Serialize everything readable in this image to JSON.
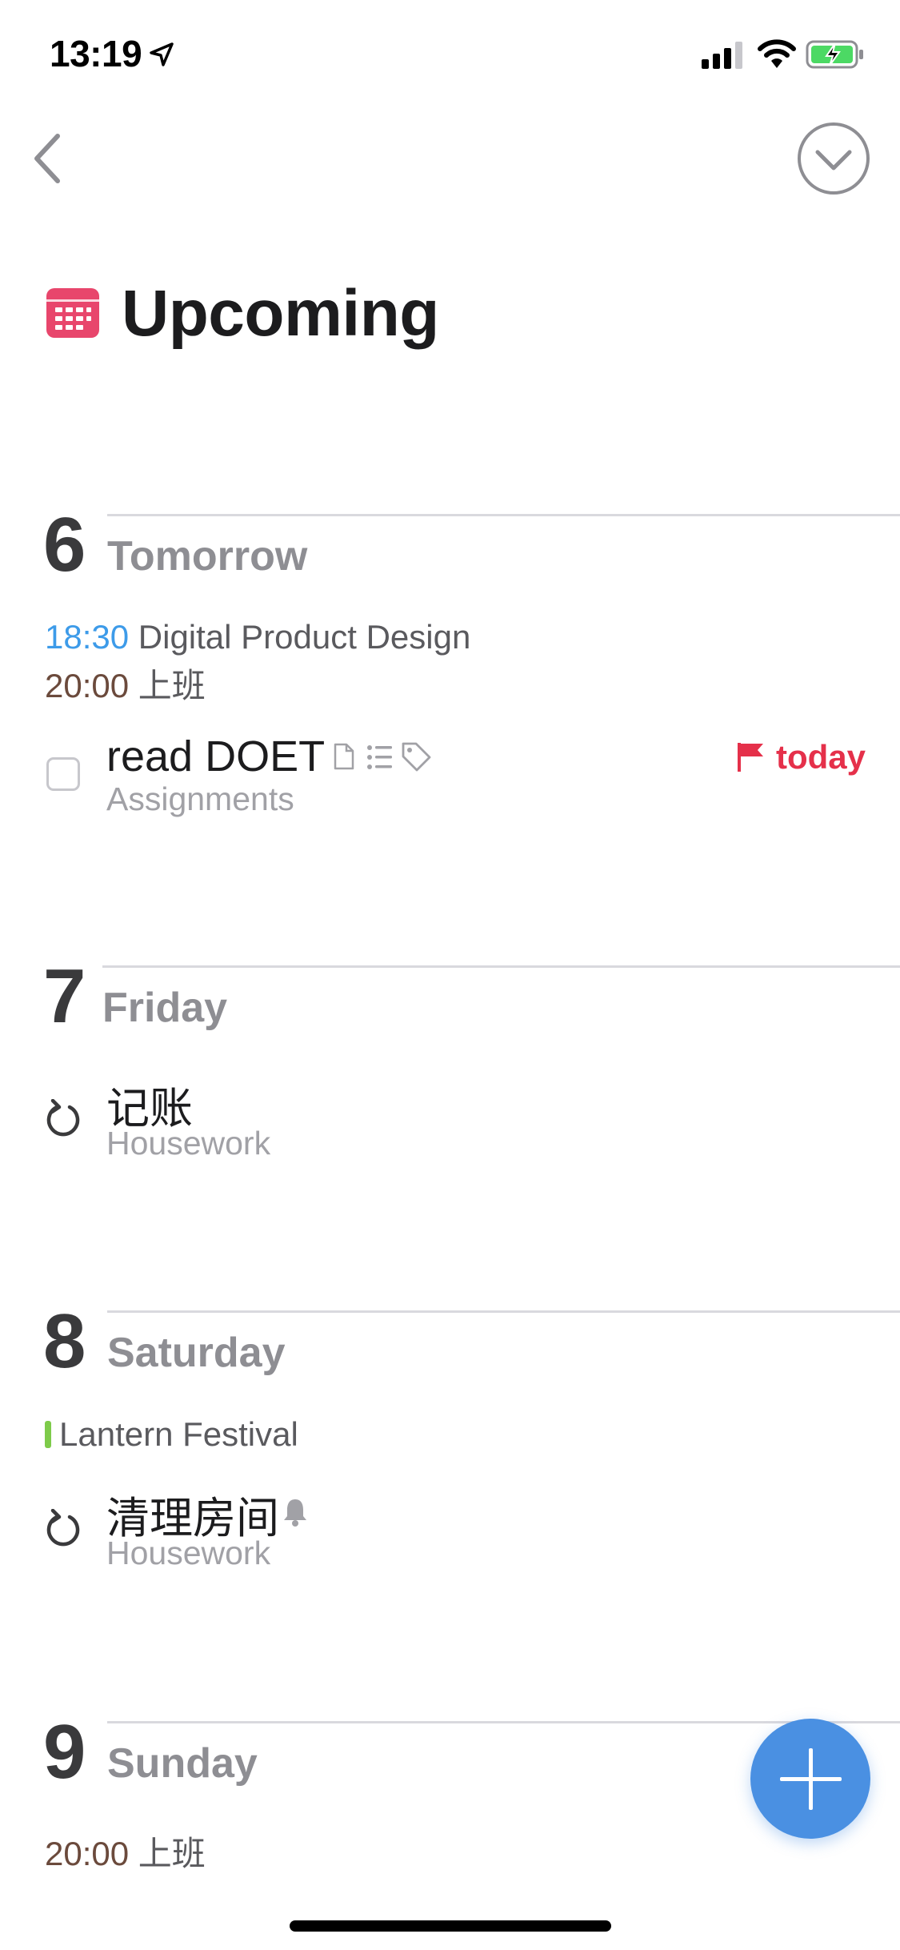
{
  "status_bar": {
    "time": "13:19",
    "icons": [
      "location-arrow-icon",
      "cellular-signal-icon",
      "wifi-icon",
      "battery-charging-icon"
    ]
  },
  "nav": {
    "back_icon": "chevron-left-icon",
    "done_icon": "checkmark-circle-icon"
  },
  "header": {
    "icon": "calendar-icon",
    "title": "Upcoming"
  },
  "days": [
    {
      "number": "6",
      "name": "Tomorrow",
      "events": [
        {
          "time": "18:30",
          "title": "Digital Product Design"
        },
        {
          "time": "20:00",
          "title": "上班"
        }
      ],
      "tasks": [
        {
          "title": "read DOET",
          "list": "Assignments",
          "icons": [
            "note-icon",
            "checklist-icon",
            "tag-icon"
          ],
          "deadline": "today"
        }
      ]
    },
    {
      "number": "7",
      "name": "Friday",
      "tasks": [
        {
          "title": "记账",
          "list": "Housework",
          "repeating": true
        }
      ]
    },
    {
      "number": "8",
      "name": "Saturday",
      "events": [
        {
          "title": "Lantern Festival"
        }
      ],
      "tasks": [
        {
          "title": "清理房间",
          "list": "Housework",
          "repeating": true,
          "icons": [
            "bell-icon"
          ]
        }
      ]
    },
    {
      "number": "9",
      "name": "Sunday",
      "events": [
        {
          "time": "20:00",
          "title": "上班"
        }
      ]
    }
  ],
  "colors": {
    "accent_blue": "#4a90e2",
    "deadline_red": "#e5304a",
    "calendar_pink": "#e8466c",
    "event_time_blue": "#3d9be9",
    "event_time_brown": "#6b4a3c",
    "holiday_green": "#7ecb4a"
  },
  "fab_icon": "plus-icon"
}
